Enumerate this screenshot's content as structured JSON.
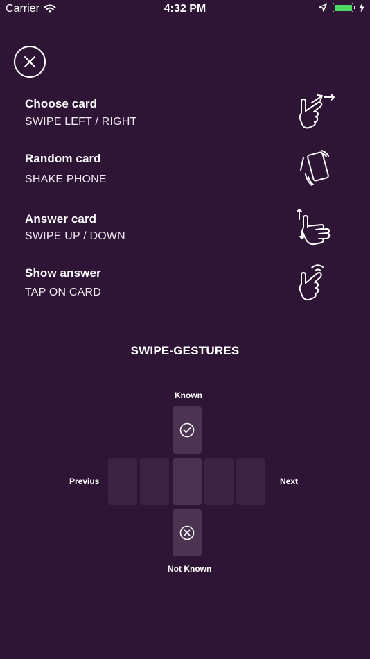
{
  "status_bar": {
    "carrier": "Carrier",
    "time": "4:32 PM",
    "battery_level": 1.0,
    "battery_color": "#4cd964"
  },
  "close_button": {
    "icon": "close-icon"
  },
  "instructions": [
    {
      "title": "Choose card",
      "subtitle": "SWIPE LEFT / RIGHT",
      "icon": "swipe-left-right-icon"
    },
    {
      "title": "Random card",
      "subtitle": "SHAKE PHONE",
      "icon": "shake-phone-icon"
    },
    {
      "title": "Answer card",
      "subtitle": "SWIPE UP / DOWN",
      "icon": "swipe-up-down-icon"
    },
    {
      "title": "Show answer",
      "subtitle": "TAP ON CARD",
      "icon": "tap-icon"
    }
  ],
  "gestures": {
    "title": "SWIPE-GESTURES",
    "known_label": "Known",
    "not_known_label": "Not Known",
    "previous_label": "Previus",
    "next_label": "Next"
  },
  "colors": {
    "background": "#2e1535",
    "tile": "#3b2342",
    "tile_center": "#4a3150",
    "tile_vertical": "#4b3351"
  }
}
